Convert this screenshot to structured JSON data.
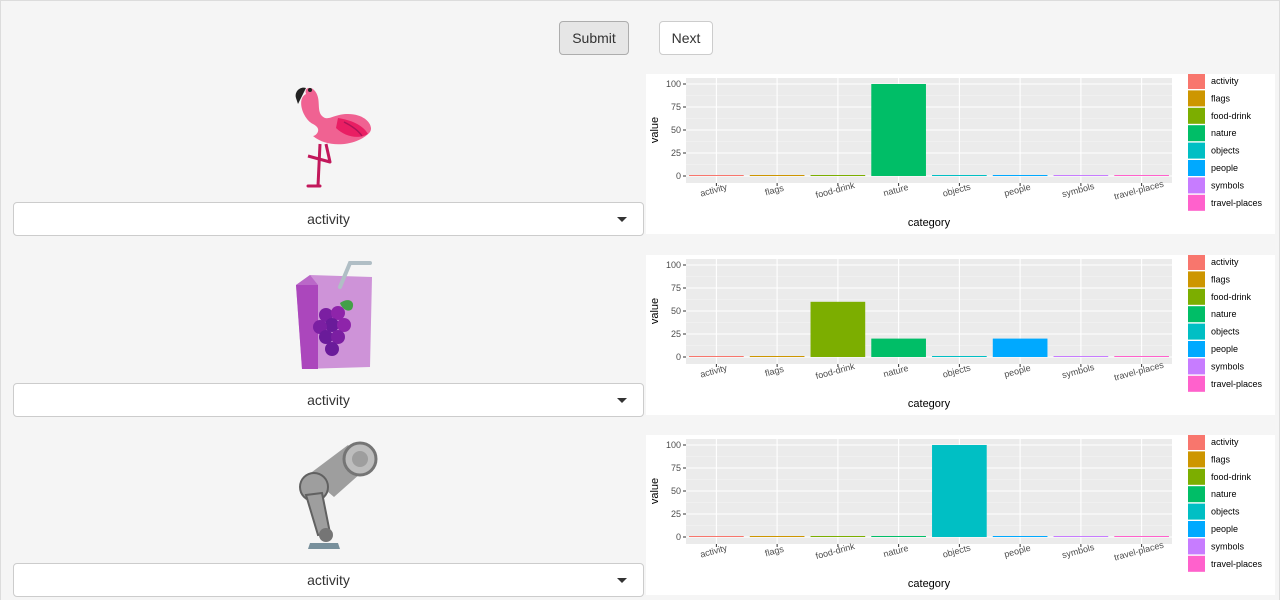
{
  "toolbar": {
    "submit_label": "Submit",
    "next_label": "Next"
  },
  "rows": [
    {
      "emoji_icon": "flamingo-icon",
      "selected": "activity"
    },
    {
      "emoji_icon": "grape-juice-box-icon",
      "selected": "activity"
    },
    {
      "emoji_icon": "mechanical-leg-icon",
      "selected": "activity"
    }
  ],
  "chart_data": [
    {
      "type": "bar",
      "xlabel": "category",
      "ylabel": "value",
      "categories": [
        "activity",
        "flags",
        "food-drink",
        "nature",
        "objects",
        "people",
        "symbols",
        "travel-places"
      ],
      "values": [
        0,
        0,
        0,
        100,
        0,
        0,
        0,
        0
      ],
      "ylim": [
        0,
        100
      ],
      "yticks": [
        0,
        25,
        50,
        75,
        100
      ],
      "legend": [
        "activity",
        "flags",
        "food-drink",
        "nature",
        "objects",
        "people",
        "symbols",
        "travel-places"
      ],
      "legend_placement": "right",
      "grid": true
    },
    {
      "type": "bar",
      "xlabel": "category",
      "ylabel": "value",
      "categories": [
        "activity",
        "flags",
        "food-drink",
        "nature",
        "objects",
        "people",
        "symbols",
        "travel-places"
      ],
      "values": [
        0,
        0,
        60,
        20,
        0,
        20,
        0,
        0
      ],
      "ylim": [
        0,
        100
      ],
      "yticks": [
        0,
        25,
        50,
        75,
        100
      ],
      "legend": [
        "activity",
        "flags",
        "food-drink",
        "nature",
        "objects",
        "people",
        "symbols",
        "travel-places"
      ],
      "legend_placement": "right",
      "grid": true
    },
    {
      "type": "bar",
      "xlabel": "category",
      "ylabel": "value",
      "categories": [
        "activity",
        "flags",
        "food-drink",
        "nature",
        "objects",
        "people",
        "symbols",
        "travel-places"
      ],
      "values": [
        0,
        0,
        0,
        0,
        100,
        0,
        0,
        0
      ],
      "ylim": [
        0,
        100
      ],
      "yticks": [
        0,
        25,
        50,
        75,
        100
      ],
      "legend": [
        "activity",
        "flags",
        "food-drink",
        "nature",
        "objects",
        "people",
        "symbols",
        "travel-places"
      ],
      "legend_placement": "right",
      "grid": true
    }
  ],
  "colors": [
    "#F8766D",
    "#CD9600",
    "#7CAE00",
    "#00BE67",
    "#00BFC4",
    "#00A9FF",
    "#C77CFF",
    "#FF61CC"
  ]
}
